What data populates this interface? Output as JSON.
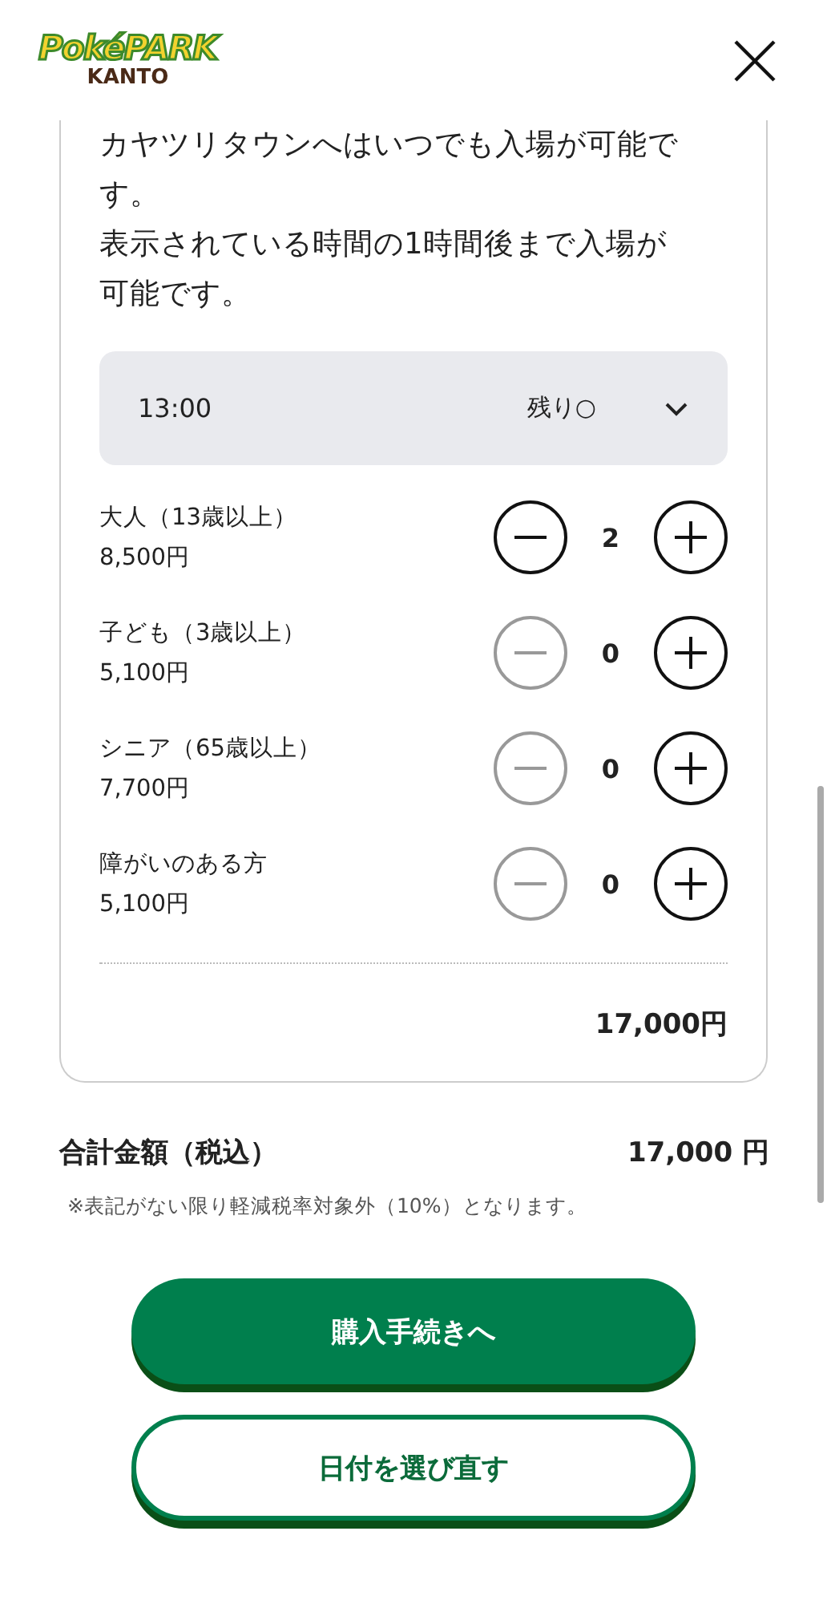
{
  "header": {
    "logo": {
      "title": "PokéPARK",
      "subtitle": "KANTO"
    }
  },
  "notice": [
    "カヤツリタウンへはいつでも入場が可能です。",
    "表示されている時間の1時間後まで入場が可能です。"
  ],
  "time_select": {
    "value": "13:00",
    "availability": "残り○"
  },
  "tickets": [
    {
      "label": "大人（13歳以上）",
      "price": "8,500円",
      "count": "2",
      "decrement_disabled": false
    },
    {
      "label": "子ども（3歳以上）",
      "price": "5,100円",
      "count": "0",
      "decrement_disabled": true
    },
    {
      "label": "シニア（65歳以上）",
      "price": "7,700円",
      "count": "0",
      "decrement_disabled": true
    },
    {
      "label": "障がいのある方",
      "price": "5,100円",
      "count": "0",
      "decrement_disabled": true
    }
  ],
  "subtotal": "17,000円",
  "total": {
    "label": "合計金額（税込）",
    "amount": "17,000 円"
  },
  "tax_note": "※表記がない限り軽減税率対象外（10%）となります。",
  "buttons": [
    {
      "label": "購入手続きへ",
      "kind": "primary"
    },
    {
      "label": "日付を選び直す",
      "kind": "secondary"
    }
  ]
}
